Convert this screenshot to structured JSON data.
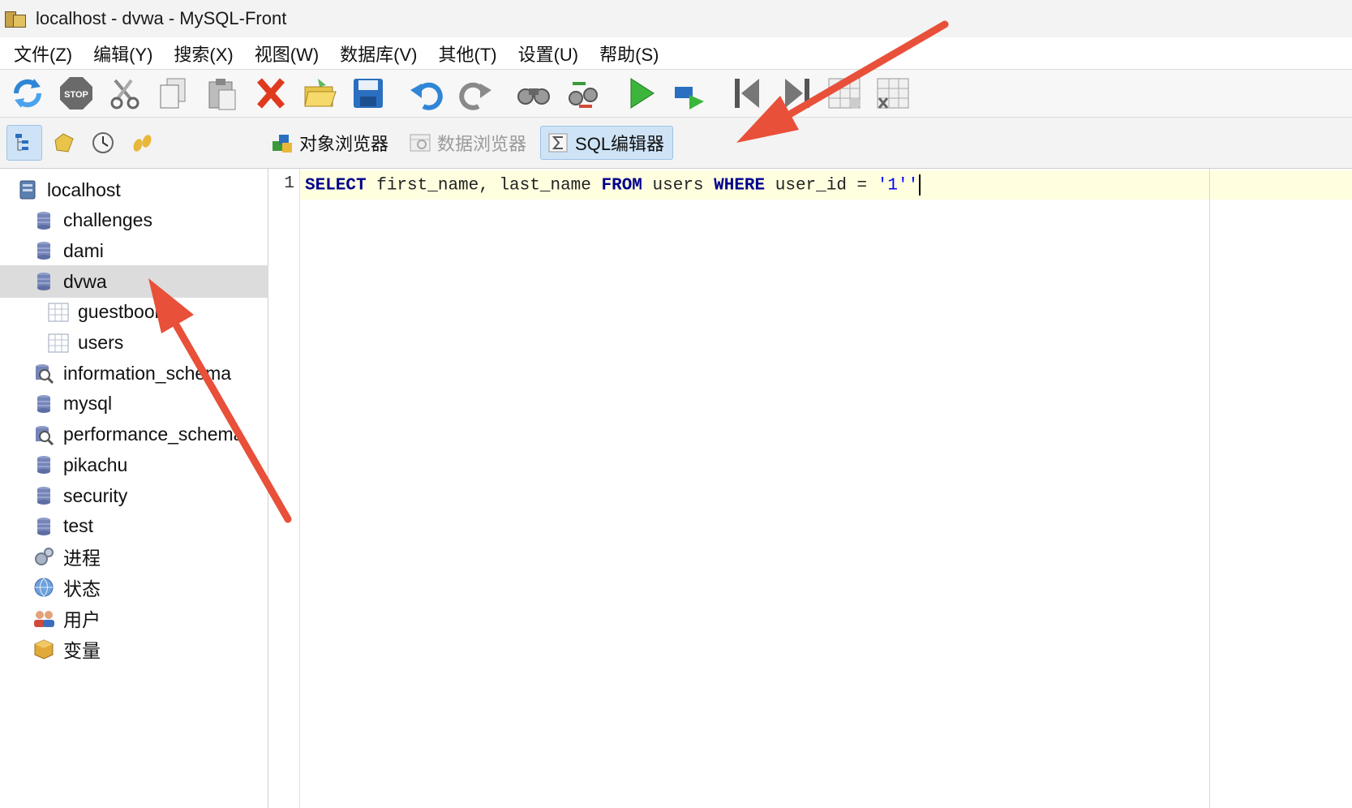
{
  "window": {
    "title": "localhost - dvwa - MySQL-Front"
  },
  "menu": {
    "items": [
      "文件(Z)",
      "编辑(Y)",
      "搜索(X)",
      "视图(W)",
      "数据库(V)",
      "其他(T)",
      "设置(U)",
      "帮助(S)"
    ]
  },
  "toolbar": {
    "icons": [
      "refresh-icon",
      "stop-icon",
      "cut-icon",
      "copy-icon",
      "paste-icon",
      "delete-icon",
      "open-icon",
      "save-icon",
      "undo-icon",
      "redo-icon",
      "find-icon",
      "replace-icon",
      "run-icon",
      "run-selection-icon",
      "first-record-icon",
      "last-record-icon",
      "insert-record-icon",
      "delete-record-icon"
    ]
  },
  "views": {
    "tabs": [
      {
        "label": "对象浏览器",
        "state": "normal",
        "icon": "object-browser-icon"
      },
      {
        "label": "数据浏览器",
        "state": "disabled",
        "icon": "data-browser-icon"
      },
      {
        "label": "SQL编辑器",
        "state": "active",
        "icon": "sql-editor-icon"
      }
    ]
  },
  "tree": {
    "items": [
      {
        "label": "localhost",
        "icon": "server-icon"
      },
      {
        "label": "challenges",
        "icon": "database-icon"
      },
      {
        "label": "dami",
        "icon": "database-icon"
      },
      {
        "label": "dvwa",
        "icon": "database-icon",
        "selected": true
      },
      {
        "label": "guestbook",
        "icon": "table-icon"
      },
      {
        "label": "users",
        "icon": "table-icon"
      },
      {
        "label": "information_schema",
        "icon": "system-database-icon"
      },
      {
        "label": "mysql",
        "icon": "database-icon"
      },
      {
        "label": "performance_schema",
        "icon": "system-database-icon"
      },
      {
        "label": "pikachu",
        "icon": "database-icon"
      },
      {
        "label": "security",
        "icon": "database-icon"
      },
      {
        "label": "test",
        "icon": "database-icon"
      },
      {
        "label": "进程",
        "icon": "processes-icon"
      },
      {
        "label": "状态",
        "icon": "status-icon"
      },
      {
        "label": "用户",
        "icon": "users-icon"
      },
      {
        "label": "变量",
        "icon": "variables-icon"
      }
    ]
  },
  "editor": {
    "line_number": "1",
    "tokens": {
      "k1": "SELECT",
      "t1": " first_name, last_name ",
      "k2": "FROM",
      "t2": " users ",
      "k3": "WHERE",
      "t3": " user_id = ",
      "s1": "'1''"
    }
  },
  "colors": {
    "annotation_arrow": "#e8503a",
    "keyword": "#00008b",
    "string": "#0000ff",
    "current_line": "#ffffe0",
    "selection": "#dcdcdc"
  }
}
